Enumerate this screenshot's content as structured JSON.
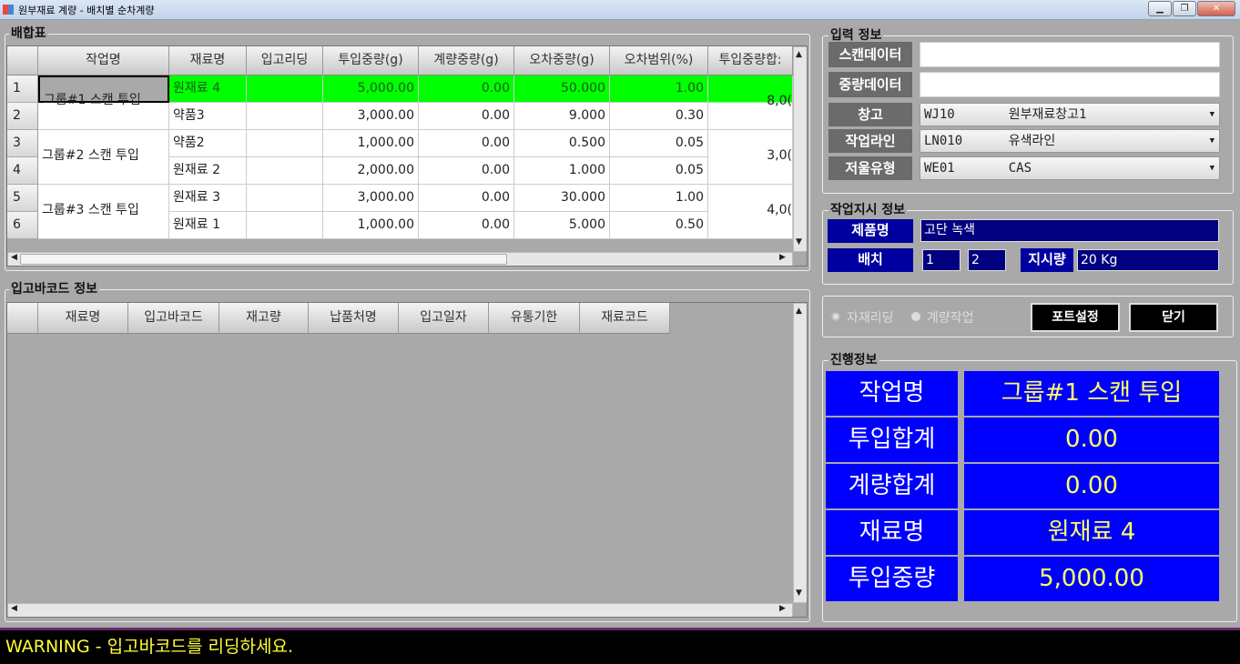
{
  "window": {
    "title": "원부재료 계량 - 배치별 순차계량",
    "minimize": "▁",
    "maximize": "❐",
    "close": "✕"
  },
  "recipe": {
    "title": "배합표",
    "columns": [
      "작업명",
      "재료명",
      "입고리딩",
      "투입중량(g)",
      "계량중량(g)",
      "오차중량(g)",
      "오차범위(%)",
      "투입중량합:"
    ],
    "rows": [
      {
        "no": "1",
        "material": "원재료 4",
        "reading": "",
        "input": "5,000.00",
        "measured": "0.00",
        "error": "50.000",
        "range": "1.00"
      },
      {
        "no": "2",
        "material": "약품3",
        "reading": "",
        "input": "3,000.00",
        "measured": "0.00",
        "error": "9.000",
        "range": "0.30"
      },
      {
        "no": "3",
        "material": "약품2",
        "reading": "",
        "input": "1,000.00",
        "measured": "0.00",
        "error": "0.500",
        "range": "0.05"
      },
      {
        "no": "4",
        "material": "원재료 2",
        "reading": "",
        "input": "2,000.00",
        "measured": "0.00",
        "error": "1.000",
        "range": "0.05"
      },
      {
        "no": "5",
        "material": "원재료 3",
        "reading": "",
        "input": "3,000.00",
        "measured": "0.00",
        "error": "30.000",
        "range": "1.00"
      },
      {
        "no": "6",
        "material": "원재료 1",
        "reading": "",
        "input": "1,000.00",
        "measured": "0.00",
        "error": "5.000",
        "range": "0.50"
      }
    ],
    "groups": [
      {
        "name": "그룹#1 스캔 투입",
        "sum": "8,0("
      },
      {
        "name": "그룹#2 스캔 투입",
        "sum": "3,0("
      },
      {
        "name": "그룹#3 스캔 투입",
        "sum": "4,0("
      }
    ],
    "selected_color": "#00ff00"
  },
  "barcode": {
    "title": "입고바코드 정보",
    "columns": [
      "재료명",
      "입고바코드",
      "재고량",
      "납품처명",
      "입고일자",
      "유통기한",
      "재료코드"
    ]
  },
  "input_info": {
    "title": "입력 정보",
    "scan_label": "스캔데이터",
    "scan_value": "",
    "weight_label": "중량데이터",
    "weight_value": "",
    "warehouse_label": "창고",
    "warehouse_value": "WJ10       원부재료창고1",
    "line_label": "작업라인",
    "line_value": "LN010      유색라인",
    "scale_label": "저울유형",
    "scale_value": "WE01       CAS"
  },
  "order_info": {
    "title": "작업지시 정보",
    "product_label": "제품명",
    "product_value": "고단 녹색",
    "batch_label": "배치",
    "batch_current": "1",
    "batch_total": "2",
    "qty_label": "지시량",
    "qty_value": "20 Kg"
  },
  "controls": {
    "radio1": "자재리딩",
    "radio2": "계량작업",
    "port_button": "포트설정",
    "close_button": "닫기"
  },
  "progress": {
    "title": "진행정보",
    "rows": [
      {
        "label": "작업명",
        "value": "그룹#1 스캔 투입"
      },
      {
        "label": "투입합계",
        "value": "0.00"
      },
      {
        "label": "계량합계",
        "value": "0.00"
      },
      {
        "label": "재료명",
        "value": "원재료 4"
      },
      {
        "label": "투입중량",
        "value": "5,000.00"
      }
    ]
  },
  "status": {
    "message": "WARNING - 입고바코드를 리딩하세요."
  },
  "colors": {
    "panel_blue": "#0000ff",
    "value_yellow": "#ffff66",
    "status_bg": "#000000",
    "status_text": "#ffff33"
  }
}
